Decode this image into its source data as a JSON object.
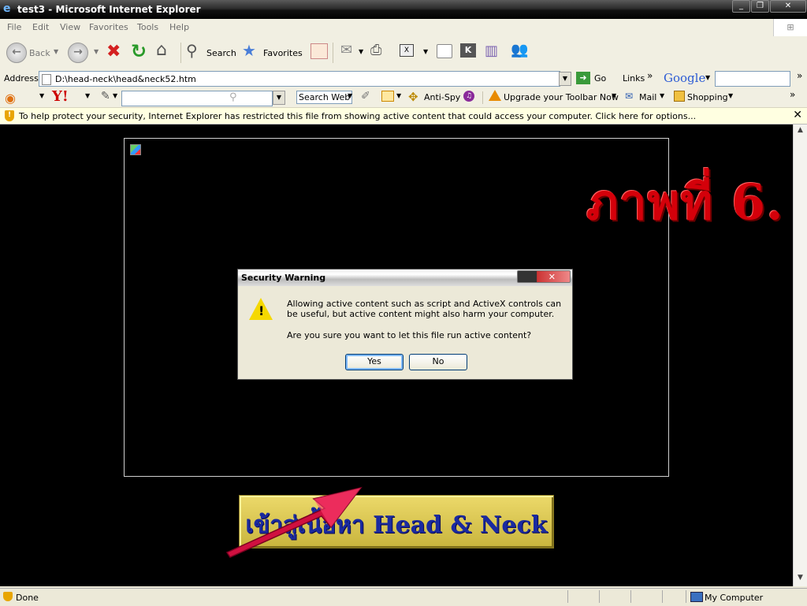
{
  "window": {
    "title": "test3 - Microsoft Internet Explorer",
    "controls": [
      "minimize",
      "maximize",
      "close"
    ]
  },
  "menubar": {
    "items": [
      "File",
      "Edit",
      "View",
      "Favorites",
      "Tools",
      "Help"
    ]
  },
  "toolbar": {
    "back_label": "Back",
    "search_label": "Search",
    "favorites_label": "Favorites"
  },
  "addressbar": {
    "label": "Address",
    "url": "D:\\head-neck\\head&neck52.htm",
    "go_label": "Go",
    "links_label": "Links",
    "google_label": "Google"
  },
  "yahoo_toolbar": {
    "search_web_label": "Search Web",
    "antispy_label": "Anti-Spy",
    "upgrade_label": "Upgrade your Toolbar Now",
    "mail_label": "Mail",
    "shopping_label": "Shopping"
  },
  "infobar": {
    "message": "To help protect your security, Internet Explorer has restricted this file from showing active content that could access your computer. Click here for options..."
  },
  "page": {
    "heading": "ภาพที่ 6.",
    "enter_button": "เข้าสู่เนื้อหา Head & Neck"
  },
  "dialog": {
    "title": "Security Warning",
    "message": "Allowing active content such as script and ActiveX controls can be useful, but active content might also harm your computer.",
    "question": "Are you sure you want to let this file run active content?",
    "yes_label": "Yes",
    "no_label": "No"
  },
  "statusbar": {
    "status": "Done",
    "zone": "My Computer"
  },
  "colors": {
    "heading_red": "#d4000a",
    "enter_button_bg": "#d8c54a",
    "enter_button_text": "#1a2aa0",
    "arrow": "#d01040",
    "page_bg": "#000000"
  }
}
